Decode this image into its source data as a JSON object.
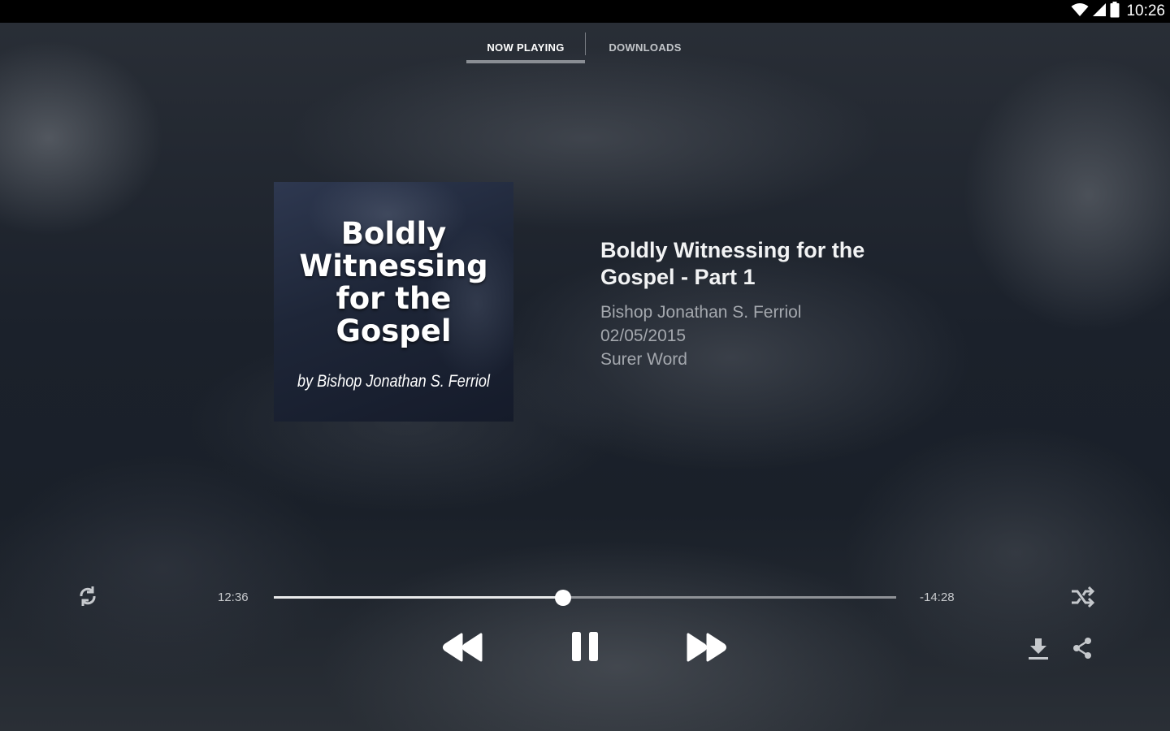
{
  "status_bar": {
    "time": "10:26",
    "icons": [
      "wifi-icon",
      "cellular-signal-icon",
      "battery-icon"
    ]
  },
  "tabs": [
    {
      "label": "NOW PLAYING",
      "active": true
    },
    {
      "label": "DOWNLOADS",
      "active": false
    }
  ],
  "artwork": {
    "title_text": "Boldly\nWitnessing\nfor the\nGospel",
    "author_text": "by Bishop Jonathan S. Ferriol"
  },
  "track": {
    "title": "Boldly Witnessing for the Gospel - Part 1",
    "speaker": "Bishop Jonathan S. Ferriol",
    "date": "02/05/2015",
    "series": "Surer Word"
  },
  "playback": {
    "elapsed": "12:36",
    "remaining": "-14:28",
    "progress": 0.465,
    "state": "playing"
  },
  "controls": {
    "left": [
      "repeat-icon"
    ],
    "transport": [
      "rewind-icon",
      "pause-icon",
      "fast-forward-icon"
    ],
    "right": [
      "shuffle-icon",
      "download-icon",
      "share-icon"
    ]
  },
  "colors": {
    "accent": "#ffffff",
    "seek_track": "#8f9297",
    "icon": "#c5c8cc"
  }
}
